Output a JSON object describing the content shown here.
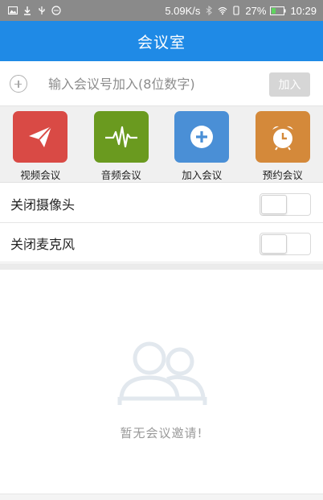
{
  "status_bar": {
    "speed": "5.09K/s",
    "battery": "27%",
    "time": "10:29",
    "left_icons": [
      "image-icon",
      "download-icon",
      "usb-icon",
      "chat-icon"
    ],
    "right_icons": [
      "bluetooth-icon",
      "wifi-icon",
      "vibrate-icon",
      "battery-icon"
    ]
  },
  "app_bar": {
    "title": "会议室"
  },
  "join": {
    "placeholder": "输入会议号加入(8位数字)",
    "button_label": "加入"
  },
  "actions": [
    {
      "label": "视频会议",
      "color": "#d94a45",
      "icon": "paper-plane-icon"
    },
    {
      "label": "音频会议",
      "color": "#6a9a1f",
      "icon": "waveform-icon"
    },
    {
      "label": "加入会议",
      "color": "#4a8fd6",
      "icon": "plus-circle-icon"
    },
    {
      "label": "预约会议",
      "color": "#d4893a",
      "icon": "alarm-clock-icon"
    }
  ],
  "toggles": [
    {
      "label": "关闭摄像头",
      "on": false
    },
    {
      "label": "关闭麦克风",
      "on": false
    }
  ],
  "empty_state": {
    "message": "暂无会议邀请!",
    "icon": "people-icon"
  }
}
